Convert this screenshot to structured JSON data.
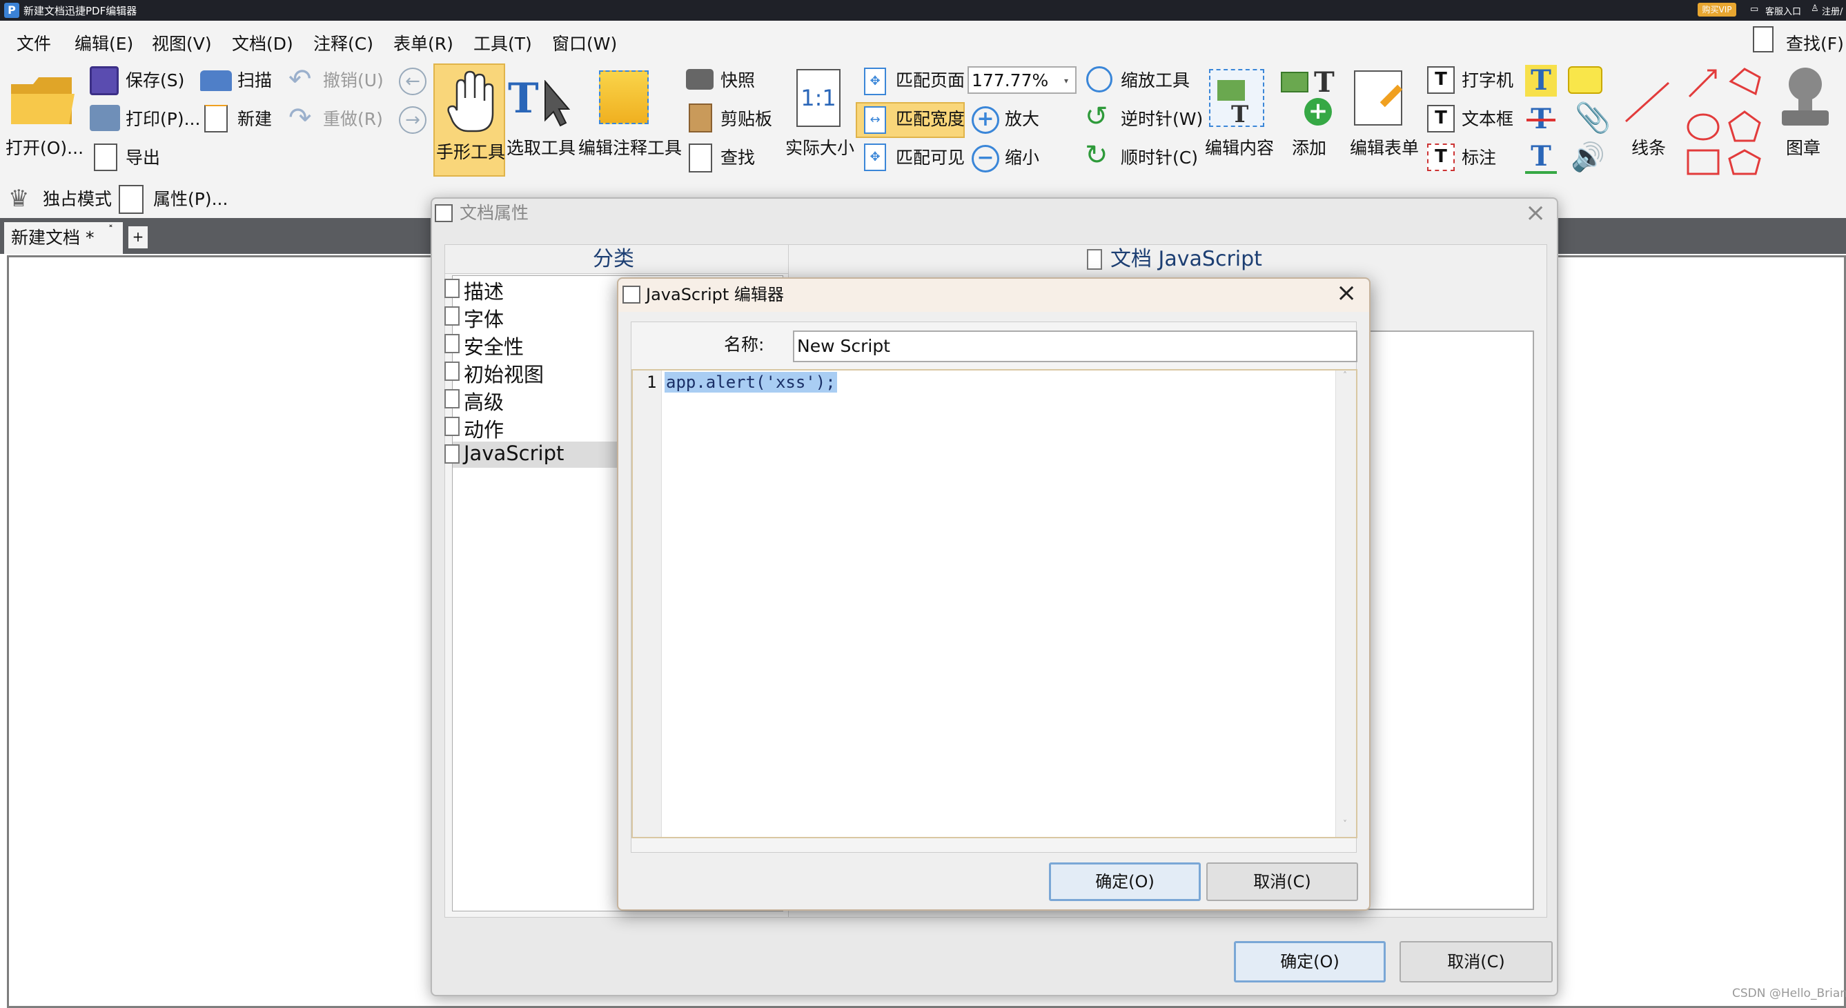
{
  "window": {
    "title": "新建文档迅捷PDF编辑器",
    "vip_label": "购买VIP",
    "service_label": "客服入口",
    "login_label": "注册/"
  },
  "menu": {
    "items": [
      "文件",
      "编辑(E)",
      "视图(V)",
      "文档(D)",
      "注释(C)",
      "表单(R)",
      "工具(T)",
      "窗口(W)"
    ],
    "find_label": "查找(F)"
  },
  "toolbar": {
    "open": "打开(O)...",
    "save": "保存(S)",
    "print": "打印(P)...",
    "export": "导出",
    "scan": "扫描",
    "new": "新建",
    "undo": "撤销(U)",
    "redo": "重做(R)",
    "hand": "手形工具",
    "select": "选取工具",
    "edit_annot": "编辑注释工具",
    "snapshot": "快照",
    "clipboard": "剪贴板",
    "find": "查找",
    "actual_size": "实际大小",
    "actual_size_icon": "1:1",
    "fit_page": "匹配页面",
    "fit_width": "匹配宽度",
    "fit_visible": "匹配可见",
    "zoom_value": "177.77%",
    "zoom_tool": "缩放工具",
    "zoom_in": "放大",
    "zoom_out": "缩小",
    "rotate_ccw": "逆时针(W)",
    "rotate_cw": "顺时针(C)",
    "edit_content": "编辑内容",
    "add": "添加",
    "edit_form": "编辑表单",
    "typewriter": "打字机",
    "textbox": "文本框",
    "callout": "标注",
    "lines": "线条",
    "stamp": "图章",
    "exclusive": "独占模式",
    "properties": "属性(P)..."
  },
  "tabs": {
    "doc_tab": "新建文档 *",
    "close": "˟",
    "add": "+"
  },
  "doc_props": {
    "title": "文档属性",
    "category_header": "分类",
    "panel_header": "文档 JavaScript",
    "categories": [
      "描述",
      "字体",
      "安全性",
      "初始视图",
      "高级",
      "动作",
      "JavaScript"
    ],
    "selected_category": "JavaScript",
    "ok": "确定(O)",
    "cancel": "取消(C)"
  },
  "js_editor": {
    "title": "JavaScript 编辑器",
    "name_label": "名称:",
    "name_value": "New Script",
    "line_number": "1",
    "code": "app.alert('xss');",
    "ok": "确定(O)",
    "cancel": "取消(C)"
  },
  "watermark": "CSDN @Hello_Brian",
  "colors": {
    "titlebar": "#1f2128",
    "accent": "#3b6fb6",
    "selection": "#a9cdf3",
    "vip": "#e8a630"
  }
}
